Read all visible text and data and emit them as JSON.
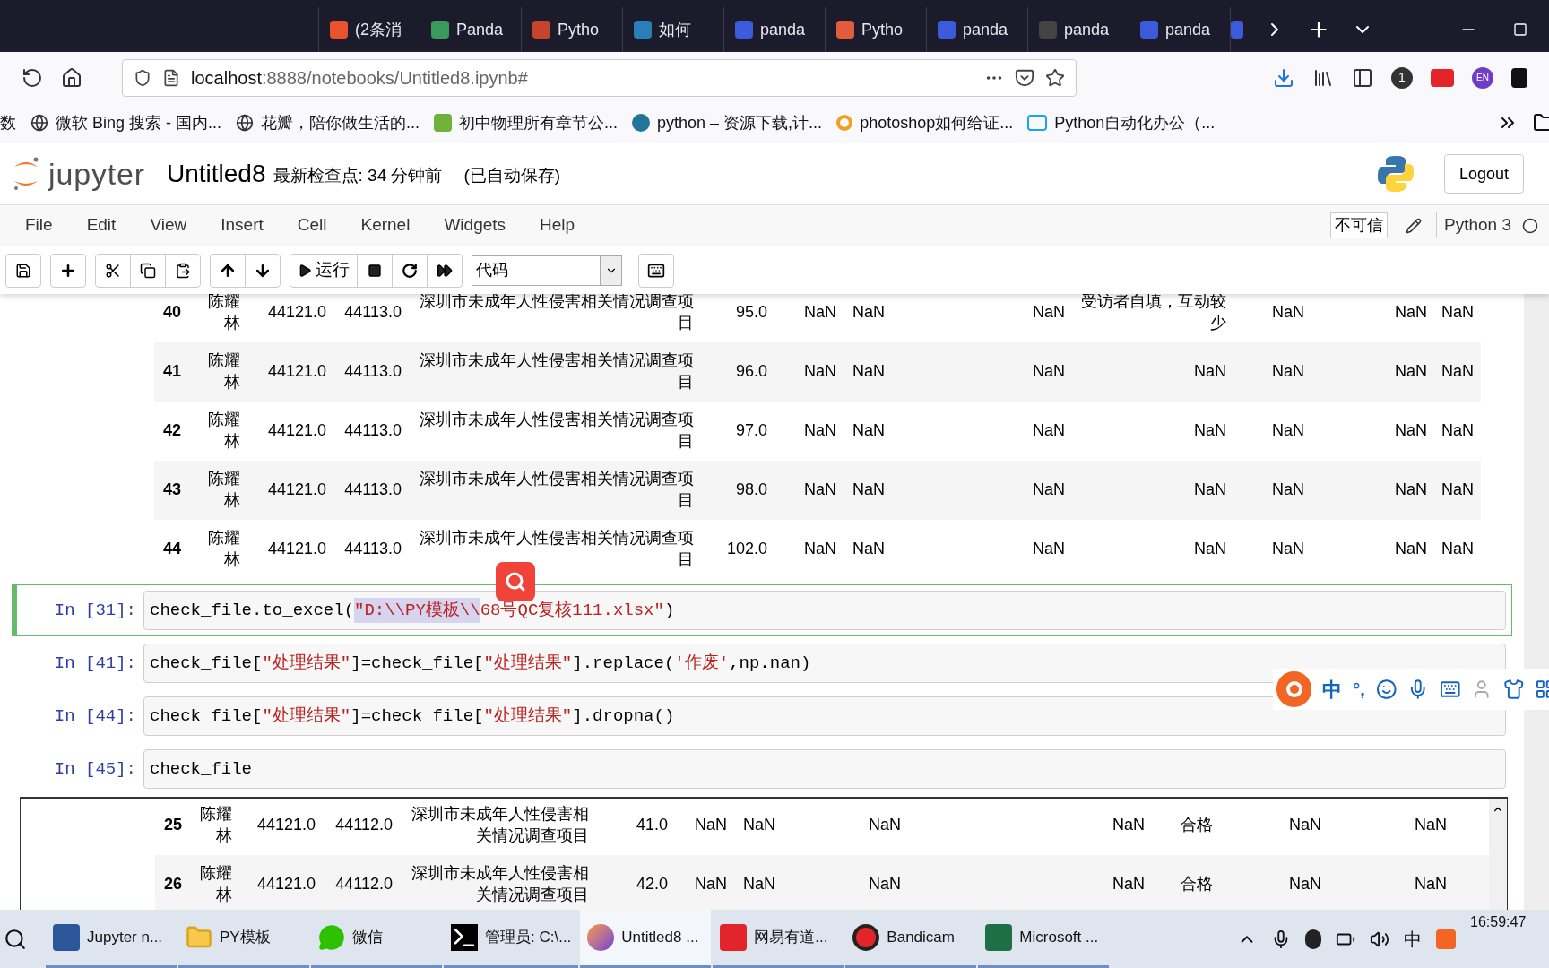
{
  "browser": {
    "tabs": [
      {
        "label": "(2条消",
        "selected": false
      },
      {
        "label": "Panda",
        "selected": false
      },
      {
        "label": "Pytho",
        "selected": false
      },
      {
        "label": "如何",
        "selected": false
      },
      {
        "label": "panda",
        "selected": false
      },
      {
        "label": "Pytho",
        "selected": false
      },
      {
        "label": "panda",
        "selected": false
      },
      {
        "label": "panda",
        "selected": false
      },
      {
        "label": "panda",
        "selected": false
      }
    ],
    "url_host": "localhost",
    "url_path": ":8888/notebooks/Untitled8.ipynb#",
    "badge": "1",
    "profile": "EN",
    "bookmarks": [
      "数",
      "微软 Bing 搜索 - 国内...",
      "花瓣，陪你做生活的...",
      "初中物理所有章节公...",
      "python – 资源下载,计...",
      "photoshop如何给证...",
      "Python自动化办公（..."
    ]
  },
  "jupyter": {
    "logo": "jupyter",
    "title": "Untitled8",
    "checkpoint": "最新检查点: 34 分钟前",
    "autosave": "(已自动保存)",
    "logout": "Logout",
    "menu": [
      "File",
      "Edit",
      "View",
      "Insert",
      "Cell",
      "Kernel",
      "Widgets",
      "Help"
    ],
    "trust": "不可信",
    "kernel": "Python 3",
    "run": "运行",
    "cell_type": "代码"
  },
  "output_1": {
    "rows": [
      {
        "index": "40",
        "column_1": "陈耀林",
        "column_2": "44121.0",
        "column_3": "44113.0",
        "column_4": "深圳市未成年人性侵害相关情况调查项目",
        "column_5": "95.0",
        "column_6": "NaN",
        "column_7": "NaN",
        "column_8": "NaN",
        "column_9": "受访者自填，互动较少",
        "column_10": "NaN",
        "column_11": "NaN",
        "column_12": "NaN"
      },
      {
        "index": "41",
        "column_1": "陈耀林",
        "column_2": "44121.0",
        "column_3": "44113.0",
        "column_4": "深圳市未成年人性侵害相关情况调查项目",
        "column_5": "96.0",
        "column_6": "NaN",
        "column_7": "NaN",
        "column_8": "NaN",
        "column_9": "NaN",
        "column_10": "NaN",
        "column_11": "NaN",
        "column_12": "NaN"
      },
      {
        "index": "42",
        "column_1": "陈耀林",
        "column_2": "44121.0",
        "column_3": "44113.0",
        "column_4": "深圳市未成年人性侵害相关情况调查项目",
        "column_5": "97.0",
        "column_6": "NaN",
        "column_7": "NaN",
        "column_8": "NaN",
        "column_9": "NaN",
        "column_10": "NaN",
        "column_11": "NaN",
        "column_12": "NaN"
      },
      {
        "index": "43",
        "column_1": "陈耀林",
        "column_2": "44121.0",
        "column_3": "44113.0",
        "column_4": "深圳市未成年人性侵害相关情况调查项目",
        "column_5": "98.0",
        "column_6": "NaN",
        "column_7": "NaN",
        "column_8": "NaN",
        "column_9": "NaN",
        "column_10": "NaN",
        "column_11": "NaN",
        "column_12": "NaN"
      },
      {
        "index": "44",
        "column_1": "陈耀林",
        "column_2": "44121.0",
        "column_3": "44113.0",
        "column_4": "深圳市未成年人性侵害相关情况调查项目",
        "column_5": "102.0",
        "column_6": "NaN",
        "column_7": "NaN",
        "column_8": "NaN",
        "column_9": "NaN",
        "column_10": "NaN",
        "column_11": "NaN",
        "column_12": "NaN"
      }
    ]
  },
  "cells": [
    {
      "prompt": "In [31]:",
      "selected": true,
      "tokens": [
        {
          "kind": "plain",
          "text": "check_file.to_excel("
        },
        {
          "kind": "selected-string",
          "text": "\"D:\\\\PY模板\\\\"
        },
        {
          "kind": "string",
          "text": "68号QC复核111.xlsx\""
        },
        {
          "kind": "plain",
          "text": ")"
        }
      ]
    },
    {
      "prompt": "In [41]:",
      "selected": false,
      "tokens": [
        {
          "kind": "plain",
          "text": "check_file["
        },
        {
          "kind": "string",
          "text": "\"处理结果\""
        },
        {
          "kind": "plain",
          "text": "]=check_file["
        },
        {
          "kind": "string",
          "text": "\"处理结果\""
        },
        {
          "kind": "plain",
          "text": "].replace("
        },
        {
          "kind": "string",
          "text": "'作废'"
        },
        {
          "kind": "plain",
          "text": ",np.nan)"
        }
      ]
    },
    {
      "prompt": "In [44]:",
      "selected": false,
      "tokens": [
        {
          "kind": "plain",
          "text": "check_file["
        },
        {
          "kind": "string",
          "text": "\"处理结果\""
        },
        {
          "kind": "plain",
          "text": "]=check_file["
        },
        {
          "kind": "string",
          "text": "\"处理结果\""
        },
        {
          "kind": "plain",
          "text": "].dropna()"
        }
      ]
    },
    {
      "prompt": "In [45]:",
      "selected": false,
      "tokens": [
        {
          "kind": "plain",
          "text": "check_file"
        }
      ]
    }
  ],
  "output_2": {
    "rows": [
      {
        "index": "25",
        "column_1": "陈耀林",
        "column_2": "44121.0",
        "column_3": "44112.0",
        "column_4": "深圳市未成年人性侵害相关情况调查项目",
        "column_5": "41.0",
        "column_6": "NaN",
        "column_7": "NaN",
        "column_8": "NaN",
        "column_9": "NaN",
        "column_10": "合格",
        "column_11": "NaN",
        "column_12": "NaN"
      },
      {
        "index": "26",
        "column_1": "陈耀林",
        "column_2": "44121.0",
        "column_3": "44112.0",
        "column_4": "深圳市未成年人性侵害相关情况调查项目",
        "column_5": "42.0",
        "column_6": "NaN",
        "column_7": "NaN",
        "column_8": "NaN",
        "column_9": "NaN",
        "column_10": "合格",
        "column_11": "NaN",
        "column_12": "NaN"
      }
    ]
  },
  "ime": {
    "mode": "中",
    "punct": "°,"
  },
  "taskbar": {
    "apps": [
      {
        "label": "Jupyter n...",
        "selected": false
      },
      {
        "label": "PY模板",
        "selected": false
      },
      {
        "label": "微信",
        "selected": false
      },
      {
        "label": "管理员: C:\\...",
        "selected": false
      },
      {
        "label": "Untitled8 ...",
        "selected": true
      },
      {
        "label": "网易有道...",
        "selected": false
      },
      {
        "label": "Bandicam",
        "selected": false
      },
      {
        "label": "Microsoft ...",
        "selected": false
      }
    ],
    "ime": "中",
    "time": "16:59:47"
  }
}
